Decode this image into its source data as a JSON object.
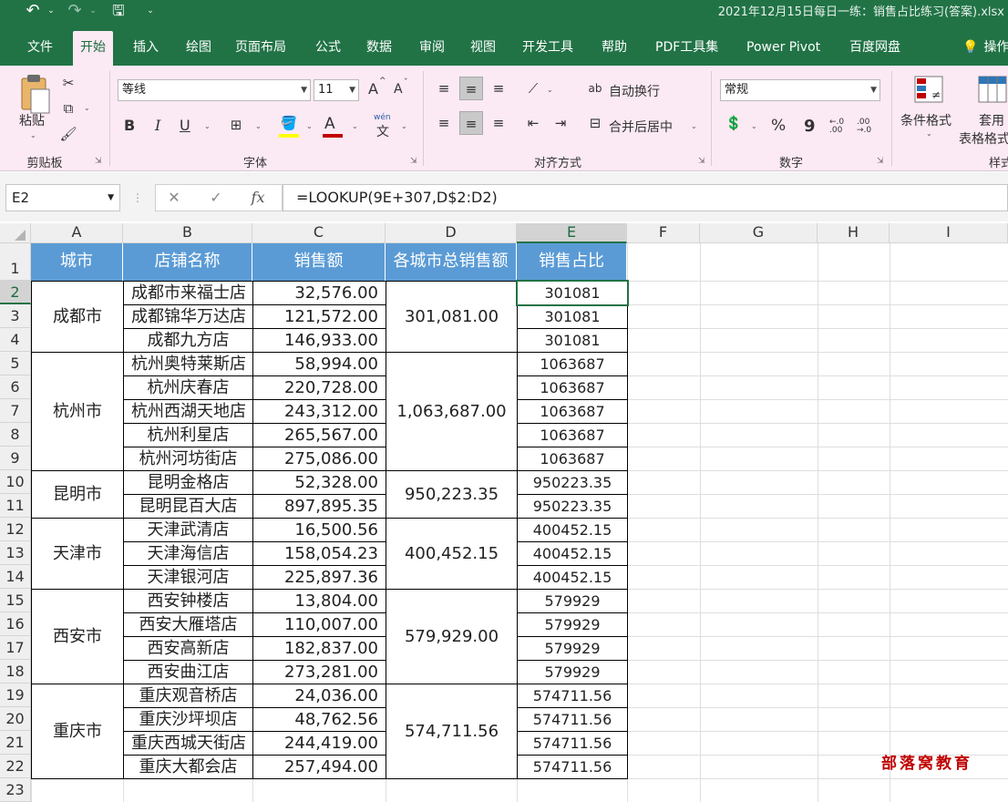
{
  "quick_access": {
    "undo_icon": "↶",
    "undo_dropdown": "⌄",
    "redo_icon": "↷",
    "redo_dropdown": "⌄",
    "save_icon": "🖫",
    "customize": "⌄"
  },
  "window": {
    "title": "2021年12月15日每日一练：销售占比练习(答案).xlsx"
  },
  "tabs": [
    "文件",
    "开始",
    "插入",
    "绘图",
    "页面布局",
    "公式",
    "数据",
    "审阅",
    "视图",
    "开发工具",
    "帮助",
    "PDF工具集",
    "Power Pivot",
    "百度网盘",
    "操作说明"
  ],
  "active_tab": "开始",
  "ribbon": {
    "clipboard": {
      "paste": "粘贴",
      "group": "剪贴板"
    },
    "font": {
      "name": "等线",
      "size": "11",
      "bold": "B",
      "italic": "I",
      "underline": "U",
      "grow": "A",
      "shrink": "A",
      "font_color": "A",
      "phonetic_top": "wén",
      "phonetic_bottom": "文",
      "group": "字体"
    },
    "alignment": {
      "wrap": "自动换行",
      "merge": "合并后居中",
      "group": "对齐方式"
    },
    "number": {
      "format": "常规",
      "percent": "%",
      "comma": "9",
      "inc_decimal": "←.0 .00",
      "dec_decimal": ".00 →.0",
      "group": "数字"
    },
    "styles": {
      "conditional": "条件格式",
      "table_top": "套用",
      "table_bottom": "表格格式",
      "group": "样式"
    }
  },
  "formula_bar": {
    "name_box": "E2",
    "cancel": "✕",
    "enter": "✓",
    "fx": "fx",
    "formula": "=LOOKUP(9E+307,D$2:D2)"
  },
  "columns": [
    "A",
    "B",
    "C",
    "D",
    "E",
    "F",
    "G",
    "H",
    "I"
  ],
  "rows": [
    "1",
    "2",
    "3",
    "4",
    "5",
    "6",
    "7",
    "8",
    "9",
    "10",
    "11",
    "12",
    "13",
    "14",
    "15",
    "16",
    "17",
    "18",
    "19",
    "20",
    "21",
    "22",
    "23"
  ],
  "table": {
    "headers": [
      "城市",
      "店铺名称",
      "销售额",
      "各城市总销售额",
      "销售占比"
    ],
    "groups": [
      {
        "city": "成都市",
        "total": "301,081.00",
        "rows": [
          {
            "store": "成都市来福士店",
            "sales": "32,576.00",
            "ratio": "301081"
          },
          {
            "store": "成都锦华万达店",
            "sales": "121,572.00",
            "ratio": "301081"
          },
          {
            "store": "成都九方店",
            "sales": "146,933.00",
            "ratio": "301081"
          }
        ]
      },
      {
        "city": "杭州市",
        "total": "1,063,687.00",
        "rows": [
          {
            "store": "杭州奥特莱斯店",
            "sales": "58,994.00",
            "ratio": "1063687"
          },
          {
            "store": "杭州庆春店",
            "sales": "220,728.00",
            "ratio": "1063687"
          },
          {
            "store": "杭州西湖天地店",
            "sales": "243,312.00",
            "ratio": "1063687"
          },
          {
            "store": "杭州利星店",
            "sales": "265,567.00",
            "ratio": "1063687"
          },
          {
            "store": "杭州河坊街店",
            "sales": "275,086.00",
            "ratio": "1063687"
          }
        ]
      },
      {
        "city": "昆明市",
        "total": "950,223.35",
        "rows": [
          {
            "store": "昆明金格店",
            "sales": "52,328.00",
            "ratio": "950223.35"
          },
          {
            "store": "昆明昆百大店",
            "sales": "897,895.35",
            "ratio": "950223.35"
          }
        ]
      },
      {
        "city": "天津市",
        "total": "400,452.15",
        "rows": [
          {
            "store": "天津武清店",
            "sales": "16,500.56",
            "ratio": "400452.15"
          },
          {
            "store": "天津海信店",
            "sales": "158,054.23",
            "ratio": "400452.15"
          },
          {
            "store": "天津银河店",
            "sales": "225,897.36",
            "ratio": "400452.15"
          }
        ]
      },
      {
        "city": "西安市",
        "total": "579,929.00",
        "rows": [
          {
            "store": "西安钟楼店",
            "sales": "13,804.00",
            "ratio": "579929"
          },
          {
            "store": "西安大雁塔店",
            "sales": "110,007.00",
            "ratio": "579929"
          },
          {
            "store": "西安高新店",
            "sales": "182,837.00",
            "ratio": "579929"
          },
          {
            "store": "西安曲江店",
            "sales": "273,281.00",
            "ratio": "579929"
          }
        ]
      },
      {
        "city": "重庆市",
        "total": "574,711.56",
        "rows": [
          {
            "store": "重庆观音桥店",
            "sales": "24,036.00",
            "ratio": "574711.56"
          },
          {
            "store": "重庆沙坪坝店",
            "sales": "48,762.56",
            "ratio": "574711.56"
          },
          {
            "store": "重庆西城天街店",
            "sales": "244,419.00",
            "ratio": "574711.56"
          },
          {
            "store": "重庆大都会店",
            "sales": "257,494.00",
            "ratio": "574711.56"
          }
        ]
      }
    ]
  },
  "watermark": "部落窝教育",
  "colors": {
    "excel_green": "#217346",
    "ribbon_bg": "#fbe9f3",
    "header_fill": "#5b9bd5",
    "watermark": "#c00000"
  }
}
